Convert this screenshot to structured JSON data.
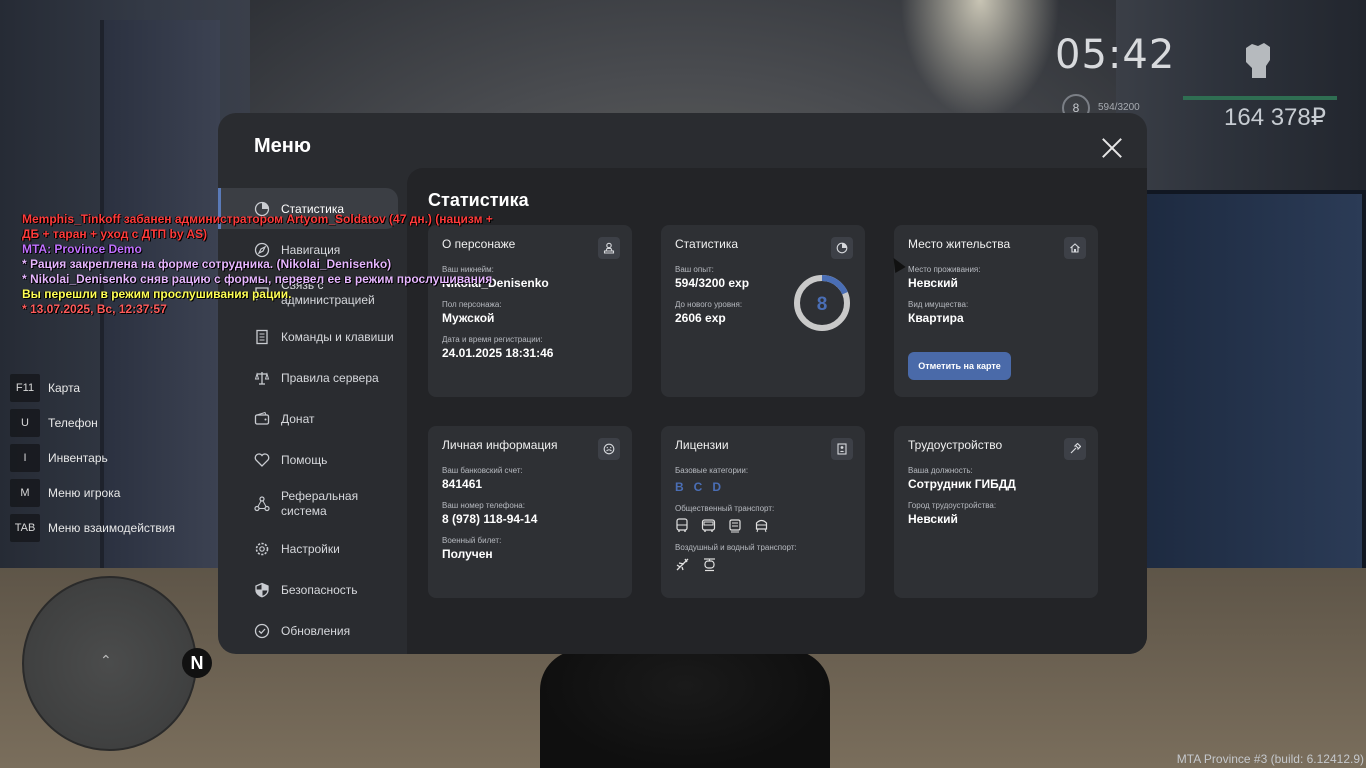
{
  "hud": {
    "time": "05:42",
    "level": "8",
    "exp": "594/3200",
    "money": "164 378₽"
  },
  "chat": [
    {
      "text": "Memphis_Tinkoff забанен администратором Artyom_Soldatov (47 дн.) (нацизм +",
      "color": "#ff3b3b"
    },
    {
      "text": " ДБ + таран + уход с ДТП by AS)",
      "color": "#ff3b3b"
    },
    {
      "text": "MTA: Province Demo",
      "color": "#c070ff"
    },
    {
      "text": "* Рация закреплена на форме сотрудника. (Nikolai_Denisenko)",
      "color": "#e6b6ff"
    },
    {
      "text": "* Nikolai_Denisenko сняв рацию с формы, перевел ее в режим прослушивания",
      "color": "#e6b6ff"
    },
    {
      "text": "Вы перешли в режим прослушивания рации.",
      "color": "#ffff55"
    },
    {
      "text": "* 13.07.2025, Вс, 12:37:57",
      "color": "#ff5b5b"
    }
  ],
  "hotkeys": [
    {
      "key": "F11",
      "label": "Карта"
    },
    {
      "key": "U",
      "label": "Телефон"
    },
    {
      "key": "I",
      "label": "Инвентарь"
    },
    {
      "key": "M",
      "label": "Меню игрока"
    },
    {
      "key": "TAB",
      "label": "Меню взаимодействия"
    }
  ],
  "minimap": {
    "north": "N"
  },
  "build": "MTA Province #3 (build: 6.12412.9)",
  "menu": {
    "title": "Меню",
    "nav": [
      {
        "label": "Статистика",
        "icon": "pie-chart-icon"
      },
      {
        "label": "Навигация",
        "icon": "compass-icon"
      },
      {
        "label": "Связь с администрацией",
        "icon": "chat-icon"
      },
      {
        "label": "Команды и клавиши",
        "icon": "document-icon"
      },
      {
        "label": "Правила сервера",
        "icon": "scales-icon"
      },
      {
        "label": "Донат",
        "icon": "wallet-icon"
      },
      {
        "label": "Помощь",
        "icon": "heart-icon"
      },
      {
        "label": "Реферальная система",
        "icon": "network-icon"
      },
      {
        "label": "Настройки",
        "icon": "gear-icon"
      },
      {
        "label": "Безопасность",
        "icon": "shield-icon"
      },
      {
        "label": "Обновления",
        "icon": "check-circle-icon"
      }
    ],
    "content_title": "Статистика",
    "cards": {
      "person": {
        "title": "О персонаже",
        "nick_label": "Ваш никнейм:",
        "nick": "Nikolai_Denisenko",
        "sex_label": "Пол персонажа:",
        "sex": "Мужской",
        "reg_label": "Дата и время регистрации:",
        "reg": "24.01.2025 18:31:46"
      },
      "stats": {
        "title": "Статистика",
        "exp_label": "Ваш опыт:",
        "exp": "594/3200 exp",
        "next_label": "До нового уровня:",
        "next": "2606 exp",
        "level": "8",
        "exp_current": 594,
        "exp_max": 3200
      },
      "residence": {
        "title": "Место жительства",
        "place_label": "Место проживания:",
        "place": "Невский",
        "property_label": "Вид имущества:",
        "property": "Квартира",
        "button": "Отметить на карте"
      },
      "personal": {
        "title": "Личная информация",
        "bank_label": "Ваш банковский счет:",
        "bank": "841461",
        "phone_label": "Ваш номер телефона:",
        "phone": "8 (978) 118-94-14",
        "military_label": "Военный билет:",
        "military": "Получен"
      },
      "licenses": {
        "title": "Лицензии",
        "base_label": "Базовые категории:",
        "base": [
          "B",
          "C",
          "D"
        ],
        "public_label": "Общественный транспорт:",
        "air_label": "Воздушный и водный транспорт:"
      },
      "job": {
        "title": "Трудоустройство",
        "position_label": "Ваша должность:",
        "position": "Сотрудник ГИБДД",
        "city_label": "Город трудоустройства:",
        "city": "Невский"
      }
    }
  }
}
